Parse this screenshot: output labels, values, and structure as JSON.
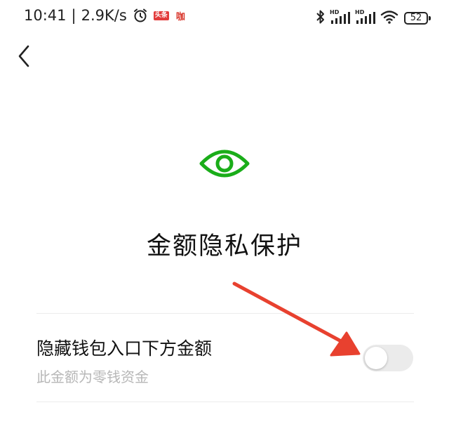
{
  "status_bar": {
    "time": "10:41",
    "network_speed": "2.9K/s",
    "separator": "|",
    "icons": [
      "alarm-icon",
      "toutiao-app-icon",
      "notification-icon",
      "bluetooth-icon",
      "hd-signal-icon",
      "hd-signal-icon",
      "wifi-icon",
      "battery-icon"
    ],
    "toutiao_label": "头条",
    "notify_label": "咖",
    "hd_label": "HD",
    "battery_level": "52"
  },
  "header": {
    "back_icon": "chevron-left-icon"
  },
  "hero": {
    "icon": "eye-icon",
    "icon_color": "#1aad19",
    "title": "金额隐私保护"
  },
  "setting": {
    "title": "隐藏钱包入口下方金额",
    "subtitle": "此金额为零钱资金",
    "toggle_on": false
  },
  "annotation": {
    "arrow_color": "#e8412f"
  }
}
